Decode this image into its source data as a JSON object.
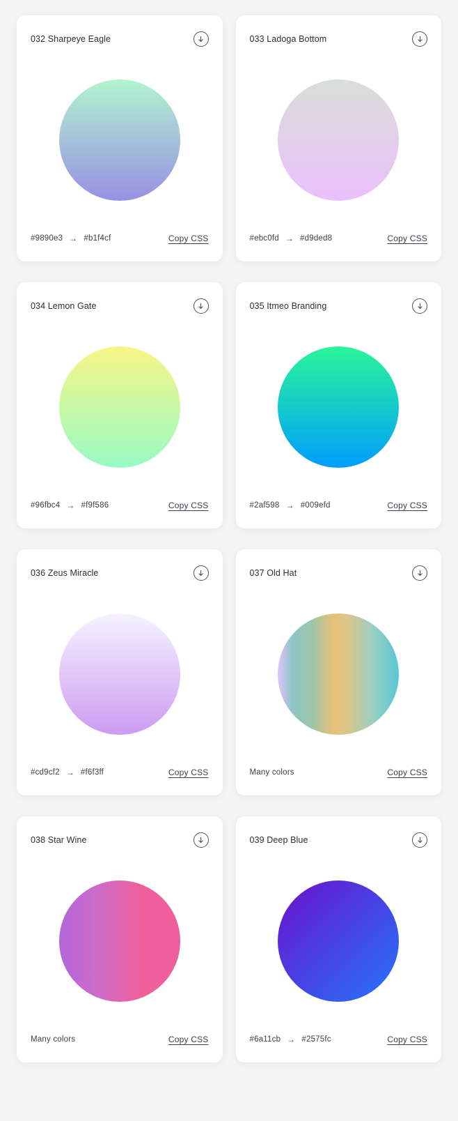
{
  "page": {
    "background": "#f4f4f4",
    "card_background": "#ffffff"
  },
  "labels": {
    "copy_css": "Copy CSS",
    "many_colors": "Many colors",
    "arrow": "→",
    "download_icon": "download-arrow-icon"
  },
  "cards": [
    {
      "title": "032 Sharpeye Eagle",
      "from": "#9890e3",
      "to": "#b1f4cf",
      "footer_kind": "hex",
      "gradient": "linear-gradient(to bottom, #b1f4cf 0%, #9890e3 100%)"
    },
    {
      "title": "033 Ladoga Bottom",
      "from": "#ebc0fd",
      "to": "#d9ded8",
      "footer_kind": "hex",
      "gradient": "linear-gradient(to bottom, #d9ded8 0%, #ebc0fd 100%)"
    },
    {
      "title": "034 Lemon Gate",
      "from": "#96fbc4",
      "to": "#f9f586",
      "footer_kind": "hex",
      "gradient": "linear-gradient(to bottom, #f9f586 0%, #96fbc4 100%)"
    },
    {
      "title": "035 Itmeo Branding",
      "from": "#2af598",
      "to": "#009efd",
      "footer_kind": "hex",
      "gradient": "linear-gradient(to bottom, #2af598 0%, #009efd 100%)"
    },
    {
      "title": "036 Zeus Miracle",
      "from": "#cd9cf2",
      "to": "#f6f3ff",
      "footer_kind": "hex",
      "gradient": "linear-gradient(to bottom, #f6f3ff 0%, #cd9cf2 100%)"
    },
    {
      "title": "037 Old Hat",
      "from": null,
      "to": null,
      "footer_kind": "many",
      "gradient": "linear-gradient(to right, #e0c3fc 0%, #8ec5c5 12%, #9bc6a8 28%, #e8c07a 46%, #d9c78a 58%, #9ccfc2 78%, #57c7d4 100%)"
    },
    {
      "title": "038 Star Wine",
      "from": null,
      "to": null,
      "footer_kind": "many",
      "gradient": "linear-gradient(to right, #b465da 0%, #cf6cc9 33%, #ee609c 66%, #ee609c 100%)"
    },
    {
      "title": "039 Deep Blue",
      "from": "#6a11cb",
      "to": "#2575fc",
      "footer_kind": "hex",
      "gradient": "linear-gradient(135deg, #6a11cb 0%, #2575fc 100%)"
    }
  ]
}
